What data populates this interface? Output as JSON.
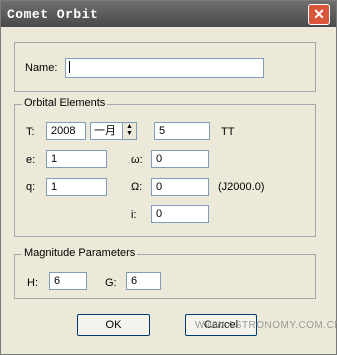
{
  "window": {
    "title": "Comet Orbit",
    "close_symbol": "✕"
  },
  "name_group": {
    "label": "Name:",
    "value": ""
  },
  "orbital": {
    "title": "Orbital Elements",
    "t_label": "T:",
    "year": "2008",
    "month": "一月",
    "day": "5",
    "tt": "TT",
    "e_label": "e:",
    "e_value": "1",
    "omega_small_label": "ω:",
    "omega_small_value": "0",
    "q_label": "q:",
    "q_value": "1",
    "omega_cap_label": "Ω:",
    "omega_cap_value": "0",
    "epoch": "(J2000.0)",
    "i_label": "i:",
    "i_value": "0"
  },
  "magnitude": {
    "title": "Magnitude Parameters",
    "h_label": "H:",
    "h_value": "6",
    "g_label": "G:",
    "g_value": "6"
  },
  "buttons": {
    "ok": "OK",
    "cancel": "Cancel"
  },
  "watermark": "WWW.ASTRONOMY.COM.CN"
}
